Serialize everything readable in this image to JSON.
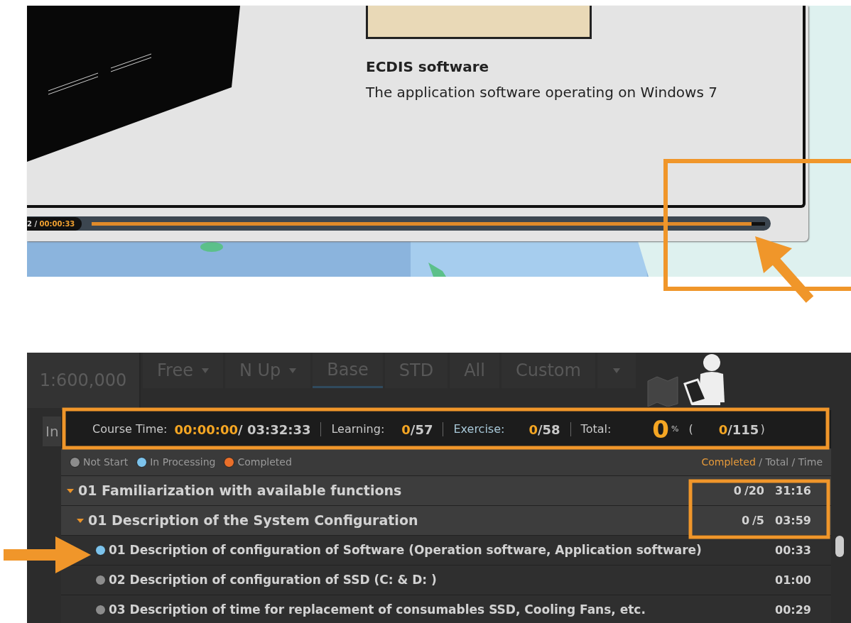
{
  "slide": {
    "title": "ECDIS software",
    "description": "The application software operating on Windows 7"
  },
  "player": {
    "elapsed": "2 /",
    "total": "00:00:33",
    "level": 0.98
  },
  "toolbar": {
    "scale": "1:600,000",
    "buttons": [
      {
        "label": "Free",
        "dropdown": true,
        "selected": false
      },
      {
        "label": "N Up",
        "dropdown": true,
        "selected": false
      },
      {
        "label": "Base",
        "dropdown": false,
        "selected": true
      },
      {
        "label": "STD",
        "dropdown": false,
        "selected": false
      },
      {
        "label": "All",
        "dropdown": false,
        "selected": false
      },
      {
        "label": "Custom",
        "dropdown": false,
        "selected": false
      },
      {
        "dropdown": true,
        "selected": false
      }
    ]
  },
  "side_tab": "In",
  "stats": {
    "course_label": "Course Time:",
    "course_elapsed": "00:00:00",
    "course_total": "/ 03:32:33",
    "learning_label": "Learning:",
    "learning_done": "0",
    "learning_total": "/57",
    "exercise_label": "Exercise:",
    "exercise_done": "0",
    "exercise_total": "/58",
    "total_label": "Total:",
    "percent": "0",
    "percent_sign": "%",
    "open_paren": "(",
    "total_done": "0",
    "total_all": "/115",
    "close_paren": ")"
  },
  "legend": [
    {
      "label": "Not Start",
      "color": "#8c8c8c"
    },
    {
      "label": "In Processing",
      "color": "#7cc3ec"
    },
    {
      "label": "Completed",
      "color": "#ea6f2a"
    }
  ],
  "columns_header": {
    "completed": "Completed",
    "rest": "/ Total / Time"
  },
  "tree": [
    {
      "title": "01 Familiarization with available functions",
      "completed": "0",
      "total": "/20",
      "time": "31:16",
      "expanded": true,
      "children": [
        {
          "title": "01 Description of the System Configuration",
          "completed": "0",
          "total": "/5",
          "time": "03:59",
          "expanded": true,
          "children": [
            {
              "title": "01 Description of configuration of Software (Operation software, Application software)",
              "time": "00:33",
              "color": "#7cc3ec"
            },
            {
              "title": "02 Description of configuration of SSD (C: & D: )",
              "time": "01:00",
              "color": "#8c8c8c"
            },
            {
              "title": "03 Description of time for replacement of consumables SSD, Cooling Fans, etc.",
              "time": "00:29",
              "color": "#8c8c8c"
            }
          ]
        }
      ]
    }
  ]
}
